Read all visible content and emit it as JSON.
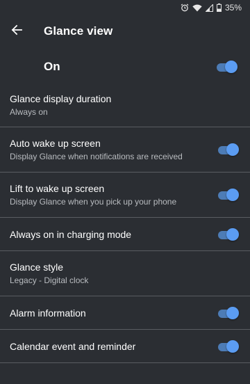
{
  "status_bar": {
    "battery_percent": "35%",
    "icons": [
      "alarm-icon",
      "wifi-icon",
      "signal-icon",
      "battery-icon"
    ]
  },
  "header": {
    "title": "Glance view",
    "back_icon": "arrow-left-icon"
  },
  "master": {
    "label": "On",
    "enabled": true
  },
  "settings": [
    {
      "title": "Glance display duration",
      "subtitle": "Always on",
      "has_toggle": false
    },
    {
      "title": "Auto wake up screen",
      "subtitle": "Display Glance when notifications are received",
      "has_toggle": true,
      "enabled": true
    },
    {
      "title": "Lift to wake up screen",
      "subtitle": "Display Glance when you pick up your phone",
      "has_toggle": true,
      "enabled": true
    },
    {
      "title": "Always on in charging mode",
      "subtitle": "",
      "has_toggle": true,
      "enabled": true
    },
    {
      "title": "Glance style",
      "subtitle": "Legacy - Digital clock",
      "has_toggle": false
    },
    {
      "title": "Alarm information",
      "subtitle": "",
      "has_toggle": true,
      "enabled": true
    },
    {
      "title": "Calendar event and reminder",
      "subtitle": "",
      "has_toggle": true,
      "enabled": true
    }
  ],
  "colors": {
    "background": "#2b2e33",
    "divider": "#5a5d62",
    "toggle_track": "#4d7cb6",
    "toggle_thumb": "#5b9cf2",
    "subtitle_text": "#b9bcc0"
  }
}
